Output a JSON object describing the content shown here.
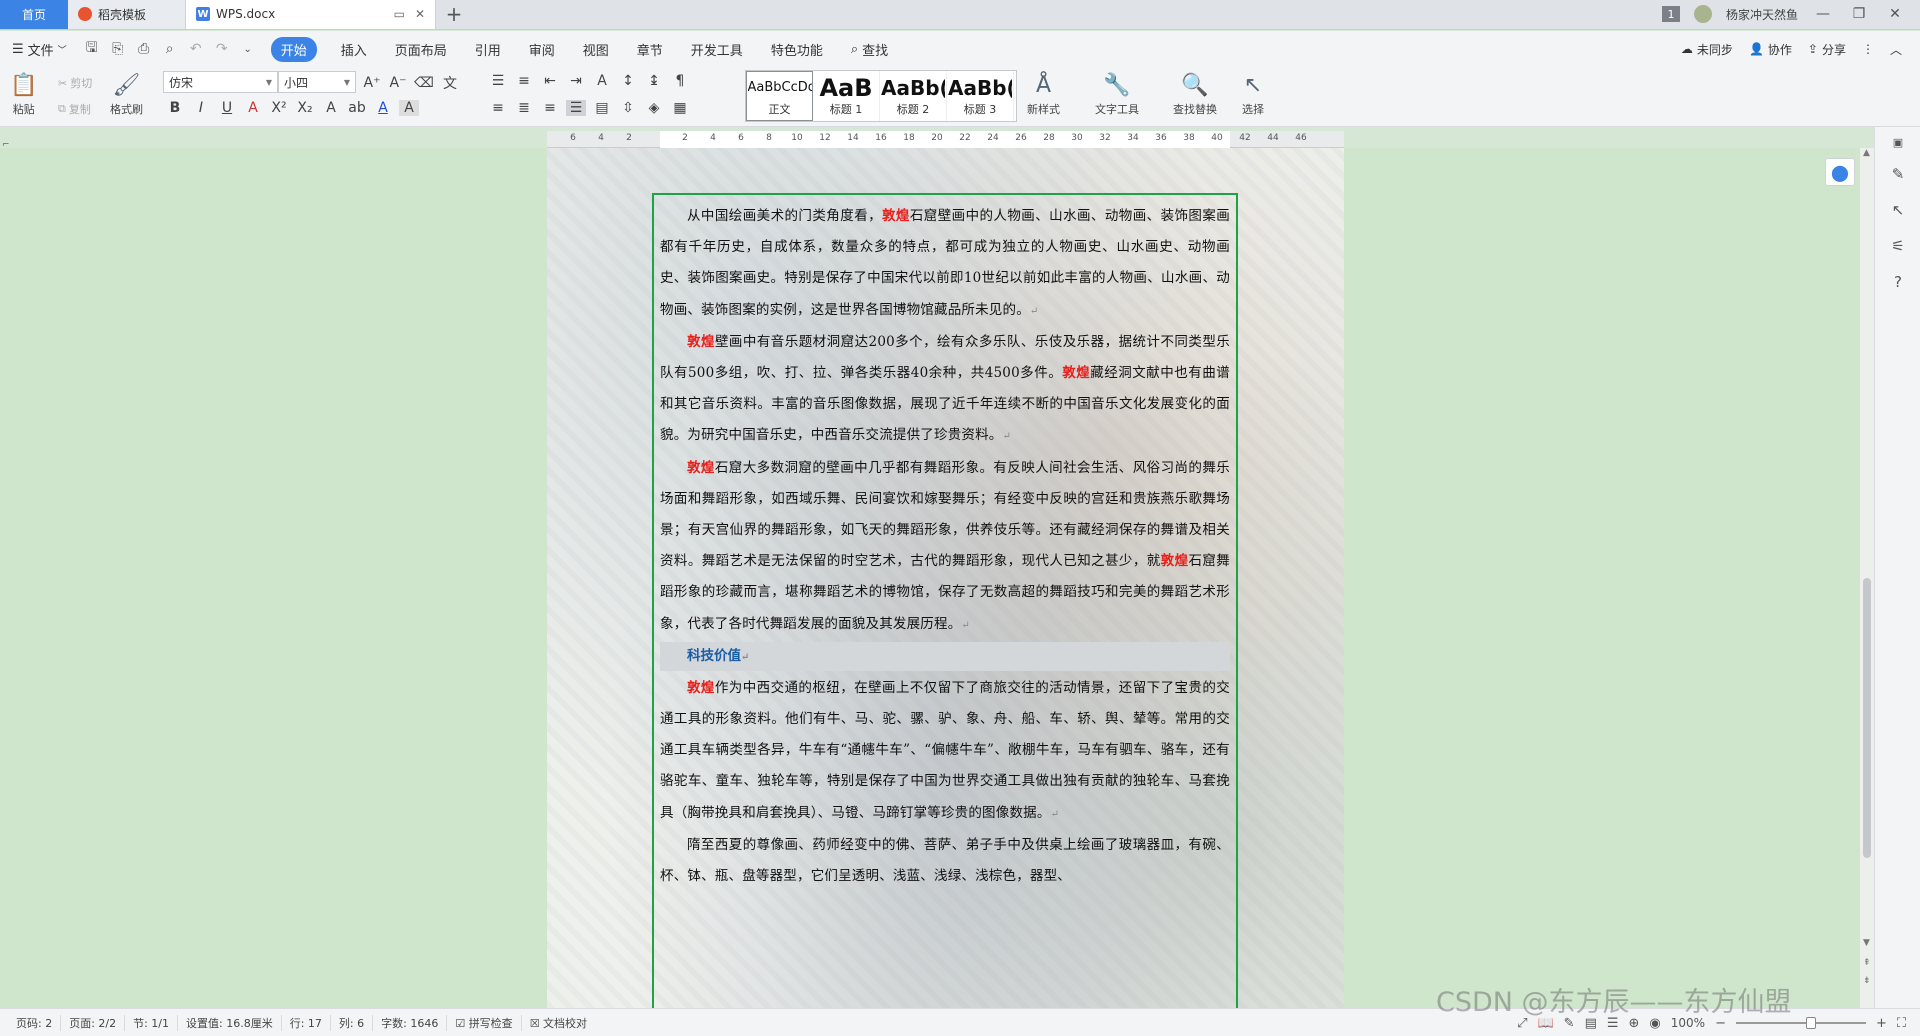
{
  "tabs": {
    "home": "首页",
    "daoke": "稻壳模板",
    "doc": "WPS.docx"
  },
  "titlebar": {
    "badge": "1",
    "user": "杨家冲天然鱼"
  },
  "menu": {
    "file": "文件",
    "items": [
      "开始",
      "插入",
      "页面布局",
      "引用",
      "审阅",
      "视图",
      "章节",
      "开发工具",
      "特色功能"
    ],
    "search": "查找",
    "sync": "未同步",
    "collab": "协作",
    "share": "分享"
  },
  "ribbon": {
    "paste": "粘贴",
    "cut": "剪切",
    "copy": "复制",
    "format_painter": "格式刷",
    "font_name": "仿宋",
    "font_size": "小四",
    "styles": [
      {
        "sample": "AaBbCcDd",
        "name": "正文"
      },
      {
        "sample": "AaB",
        "name": "标题 1"
      },
      {
        "sample": "AaBb(",
        "name": "标题 2"
      },
      {
        "sample": "AaBb(",
        "name": "标题 3"
      }
    ],
    "new_style": "新样式",
    "text_tools": "文字工具",
    "find_replace": "查找替换",
    "select": "选择"
  },
  "ruler": {
    "ticks": [
      "6",
      "4",
      "2",
      "2",
      "4",
      "6",
      "8",
      "10",
      "12",
      "14",
      "16",
      "18",
      "20",
      "22",
      "24",
      "26",
      "28",
      "30",
      "32",
      "34",
      "36",
      "38",
      "40",
      "42",
      "44",
      "46"
    ]
  },
  "document": {
    "p1_before": "从中国绘画美术的门类角度看，",
    "p1_kw": "敦煌",
    "p1_after": "石窟壁画中的人物画、山水画、动物画、装饰图案画都有千年历史，自成体系，数量众多的特点，都可成为独立的人物画史、山水画史、动物画史、装饰图案画史。特别是保存了中国宋代以前即10世纪以前如此丰富的人物画、山水画、动物画、装饰图案的实例，这是世界各国博物馆藏品所未见的。",
    "p2_kw": "敦煌",
    "p2_text": "壁画中有音乐题材洞窟达200多个，绘有众多乐队、乐伎及乐器，据统计不同类型乐队有500多组，吹、打、拉、弹各类乐器40余种，共4500多件。",
    "p2_kw2": "敦煌",
    "p2_text2": "藏经洞文献中也有曲谱和其它音乐资料。丰富的音乐图像数据，展现了近千年连续不断的中国音乐文化发展变化的面貌。为研究中国音乐史，中西音乐交流提供了珍贵资料。",
    "p3_kw": "敦煌",
    "p3_text": "石窟大多数洞窟的壁画中几乎都有舞蹈形象。有反映人间社会生活、风俗习尚的舞乐场面和舞蹈形象，如西域乐舞、民间宴饮和嫁娶舞乐；有经变中反映的宫廷和贵族燕乐歌舞场景；有天宫仙界的舞蹈形象，如飞天的舞蹈形象，供养伎乐等。还有藏经洞保存的舞谱及相关资料。舞蹈艺术是无法保留的时空艺术，古代的舞蹈形象，现代人已知之甚少，就",
    "p3_kw2": "敦煌",
    "p3_text2": "石窟舞蹈形象的珍藏而言，堪称舞蹈艺术的博物馆，保存了无数高超的舞蹈技巧和完美的舞蹈艺术形象，代表了各时代舞蹈发展的面貌及其发展历程。",
    "heading": "科技价值",
    "p4_kw": "敦煌",
    "p4_text": "作为中西交通的枢纽，在壁画上不仅留下了商旅交往的活动情景，还留下了宝贵的交通工具的形象资料。他们有牛、马、驼、骡、驴、象、舟、船、车、轿、舆、辇等。常用的交通工具车辆类型各异，牛车有“通幰牛车”、“偏幰牛车”、敞棚牛车，马车有驷车、骆车，还有骆驼车、童车、独轮车等，特别是保存了中国为世界交通工具做出独有贡献的独轮车、马套挽具（胸带挽具和肩套挽具）、马镫、马蹄钉掌等珍贵的图像数据。",
    "p5_text": "隋至西夏的尊像画、药师经变中的佛、菩萨、弟子手中及供桌上绘画了玻璃器皿，有碗、杯、钵、瓶、盘等器型，它们呈透明、浅蓝、浅绿、浅棕色，器型、"
  },
  "status": {
    "page_code": "页码: 2",
    "page": "页面: 2/2",
    "section": "节: 1/1",
    "setting": "设置值: 16.8厘米",
    "row": "行: 17",
    "col": "列: 6",
    "words": "字数: 1646",
    "spell": "拼写检查",
    "proof": "文档校对",
    "zoom": "100%"
  },
  "watermark": "CSDN @东方辰——东方仙盟",
  "colors": {
    "accent": "#3c83e6",
    "frame": "#1fa148",
    "keyword": "#e8201b",
    "heading": "#1a5ea8",
    "workspace": "#cfe6cd"
  }
}
